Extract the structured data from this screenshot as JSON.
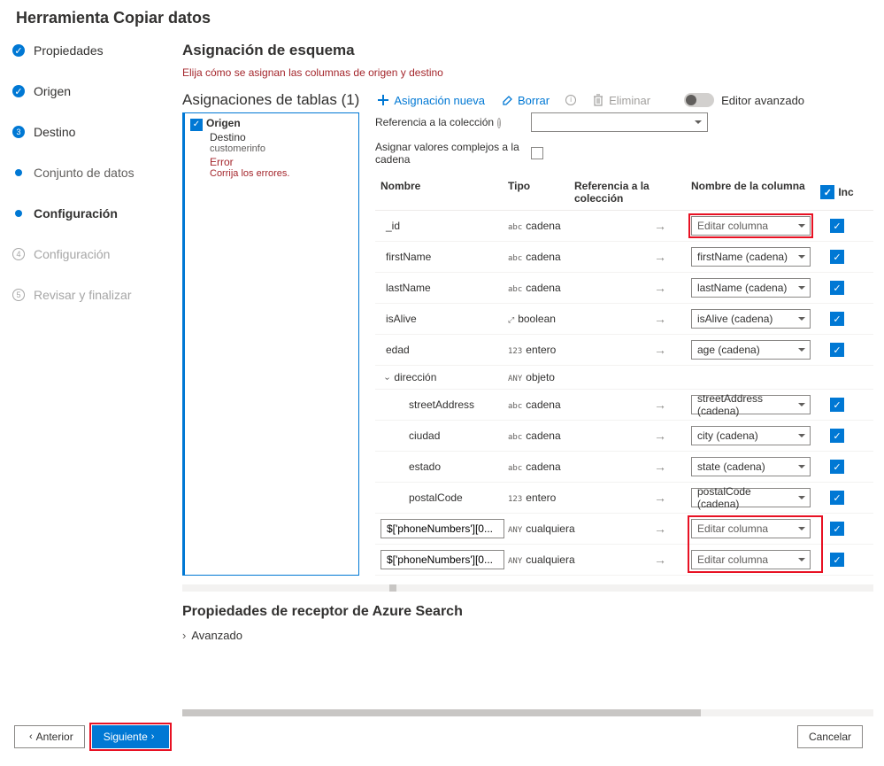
{
  "header": {
    "title": "Herramienta Copiar datos"
  },
  "sidebar": {
    "steps": {
      "properties": "Propiedades",
      "source": "Origen",
      "destination": "Destino",
      "dataset": "Conjunto de datos",
      "configuration": "Configuración",
      "config2": "Configuración",
      "review": "Revisar y finalizar"
    },
    "nums": {
      "dest": "3",
      "cfg": "4",
      "rev": "5"
    }
  },
  "main": {
    "title": "Asignación de esquema",
    "subtitle": "Elija cómo se asignan las columnas de origen y destino",
    "tmap_title": "Asignaciones de tablas (1)",
    "buttons": {
      "new": "Asignación nueva",
      "clear": "Borrar",
      "delete": "Eliminar",
      "editor": "Editor avanzado"
    },
    "tmap": {
      "source": "Origen",
      "dest": "Destino",
      "destval": "customerinfo",
      "error": "Error",
      "fix": "Corrija los errores."
    },
    "ref": {
      "collection": "Referencia a la colección",
      "complex": "Asignar valores complejos a la cadena"
    },
    "grid": {
      "headers": {
        "name": "Nombre",
        "type": "Tipo",
        "ref": "Referencia a la colección",
        "col": "Nombre de la columna",
        "inc": "Inc"
      },
      "rows": [
        {
          "name": "_id",
          "typeic": "abc",
          "type": "cadena",
          "col": "Editar columna",
          "ph": true,
          "hl": true,
          "inc": true
        },
        {
          "name": "firstName",
          "typeic": "abc",
          "type": "cadena",
          "col": "firstName (cadena)",
          "inc": true
        },
        {
          "name": "lastName",
          "typeic": "abc",
          "type": "cadena",
          "col": "lastName (cadena)",
          "inc": true
        },
        {
          "name": "isAlive",
          "typeic": "⤢",
          "type": "boolean",
          "col": "isAlive (cadena)",
          "inc": true
        },
        {
          "name": "edad",
          "typeic": "123",
          "type": "entero",
          "col": "age (cadena)",
          "inc": true
        },
        {
          "name": "dirección",
          "typeic": "ANY",
          "type": "objeto",
          "group": true
        },
        {
          "name": "streetAddress",
          "typeic": "abc",
          "type": "cadena",
          "col": "streetAddress (cadena)",
          "indent": true,
          "inc": true
        },
        {
          "name": "ciudad",
          "typeic": "abc",
          "type": "cadena",
          "col": "city (cadena)",
          "indent": true,
          "inc": true
        },
        {
          "name": "estado",
          "typeic": "abc",
          "type": "cadena",
          "col": "state (cadena)",
          "indent": true,
          "inc": true
        },
        {
          "name": "postalCode",
          "typeic": "123",
          "type": "entero",
          "col": "postalCode (cadena)",
          "indent": true,
          "inc": true
        },
        {
          "name": "$['phoneNumbers'][0...",
          "typeic": "ANY",
          "type": "cualquiera",
          "col": "Editar columna",
          "ph": true,
          "hl2": true,
          "input": true,
          "inc": true
        },
        {
          "name": "$['phoneNumbers'][0...",
          "typeic": "ANY",
          "type": "cualquiera",
          "col": "Editar columna",
          "ph": true,
          "hl2": true,
          "input": true,
          "inc": true
        }
      ]
    },
    "sink_title": "Propiedades de receptor de Azure Search",
    "advanced": "Avanzado"
  },
  "footer": {
    "prev": "Anterior",
    "next": "Siguiente",
    "cancel": "Cancelar"
  }
}
